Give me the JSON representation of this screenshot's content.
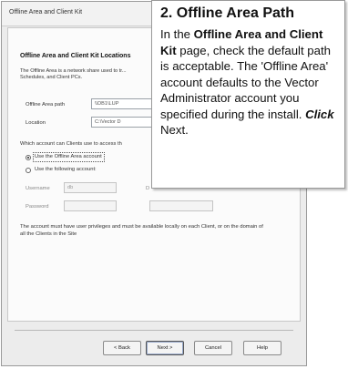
{
  "dialog": {
    "title": "Offline Area and Client Kit",
    "heading": "Offline Area and Client Kit Locations",
    "description": "The Offline Area is a network share used to tr... Schedules, and Client PCs.",
    "offline_area_path": {
      "label": "Offline Area path",
      "value": "\\\\DB1\\LUP"
    },
    "location": {
      "label": "Location",
      "value": "C:\\Vector D"
    },
    "account_question": "Which account can Clients use to access th",
    "radio_offline": "Use the Offline Area account",
    "radio_following": "Use the following account:",
    "username": {
      "label": "Username",
      "value": "db",
      "trailing": "D"
    },
    "password": {
      "label": "Password",
      "value": ""
    },
    "note": "The account must have user privileges and must be available locally on each Client, or on the domain of all the Clients in the Site",
    "buttons": {
      "back": "< Back",
      "next": "Next >",
      "cancel": "Cancel",
      "help": "Help"
    }
  },
  "callout": {
    "title": "2. Offline Area Path",
    "body_1": "In the ",
    "body_bold": "Offline Area and Client Kit",
    "body_2": " page, check the default path is acceptable. The 'Offline Area' account defaults to the Vector Administrator account you specified during the install. ",
    "body_click": "Click",
    "body_3": " Next."
  }
}
